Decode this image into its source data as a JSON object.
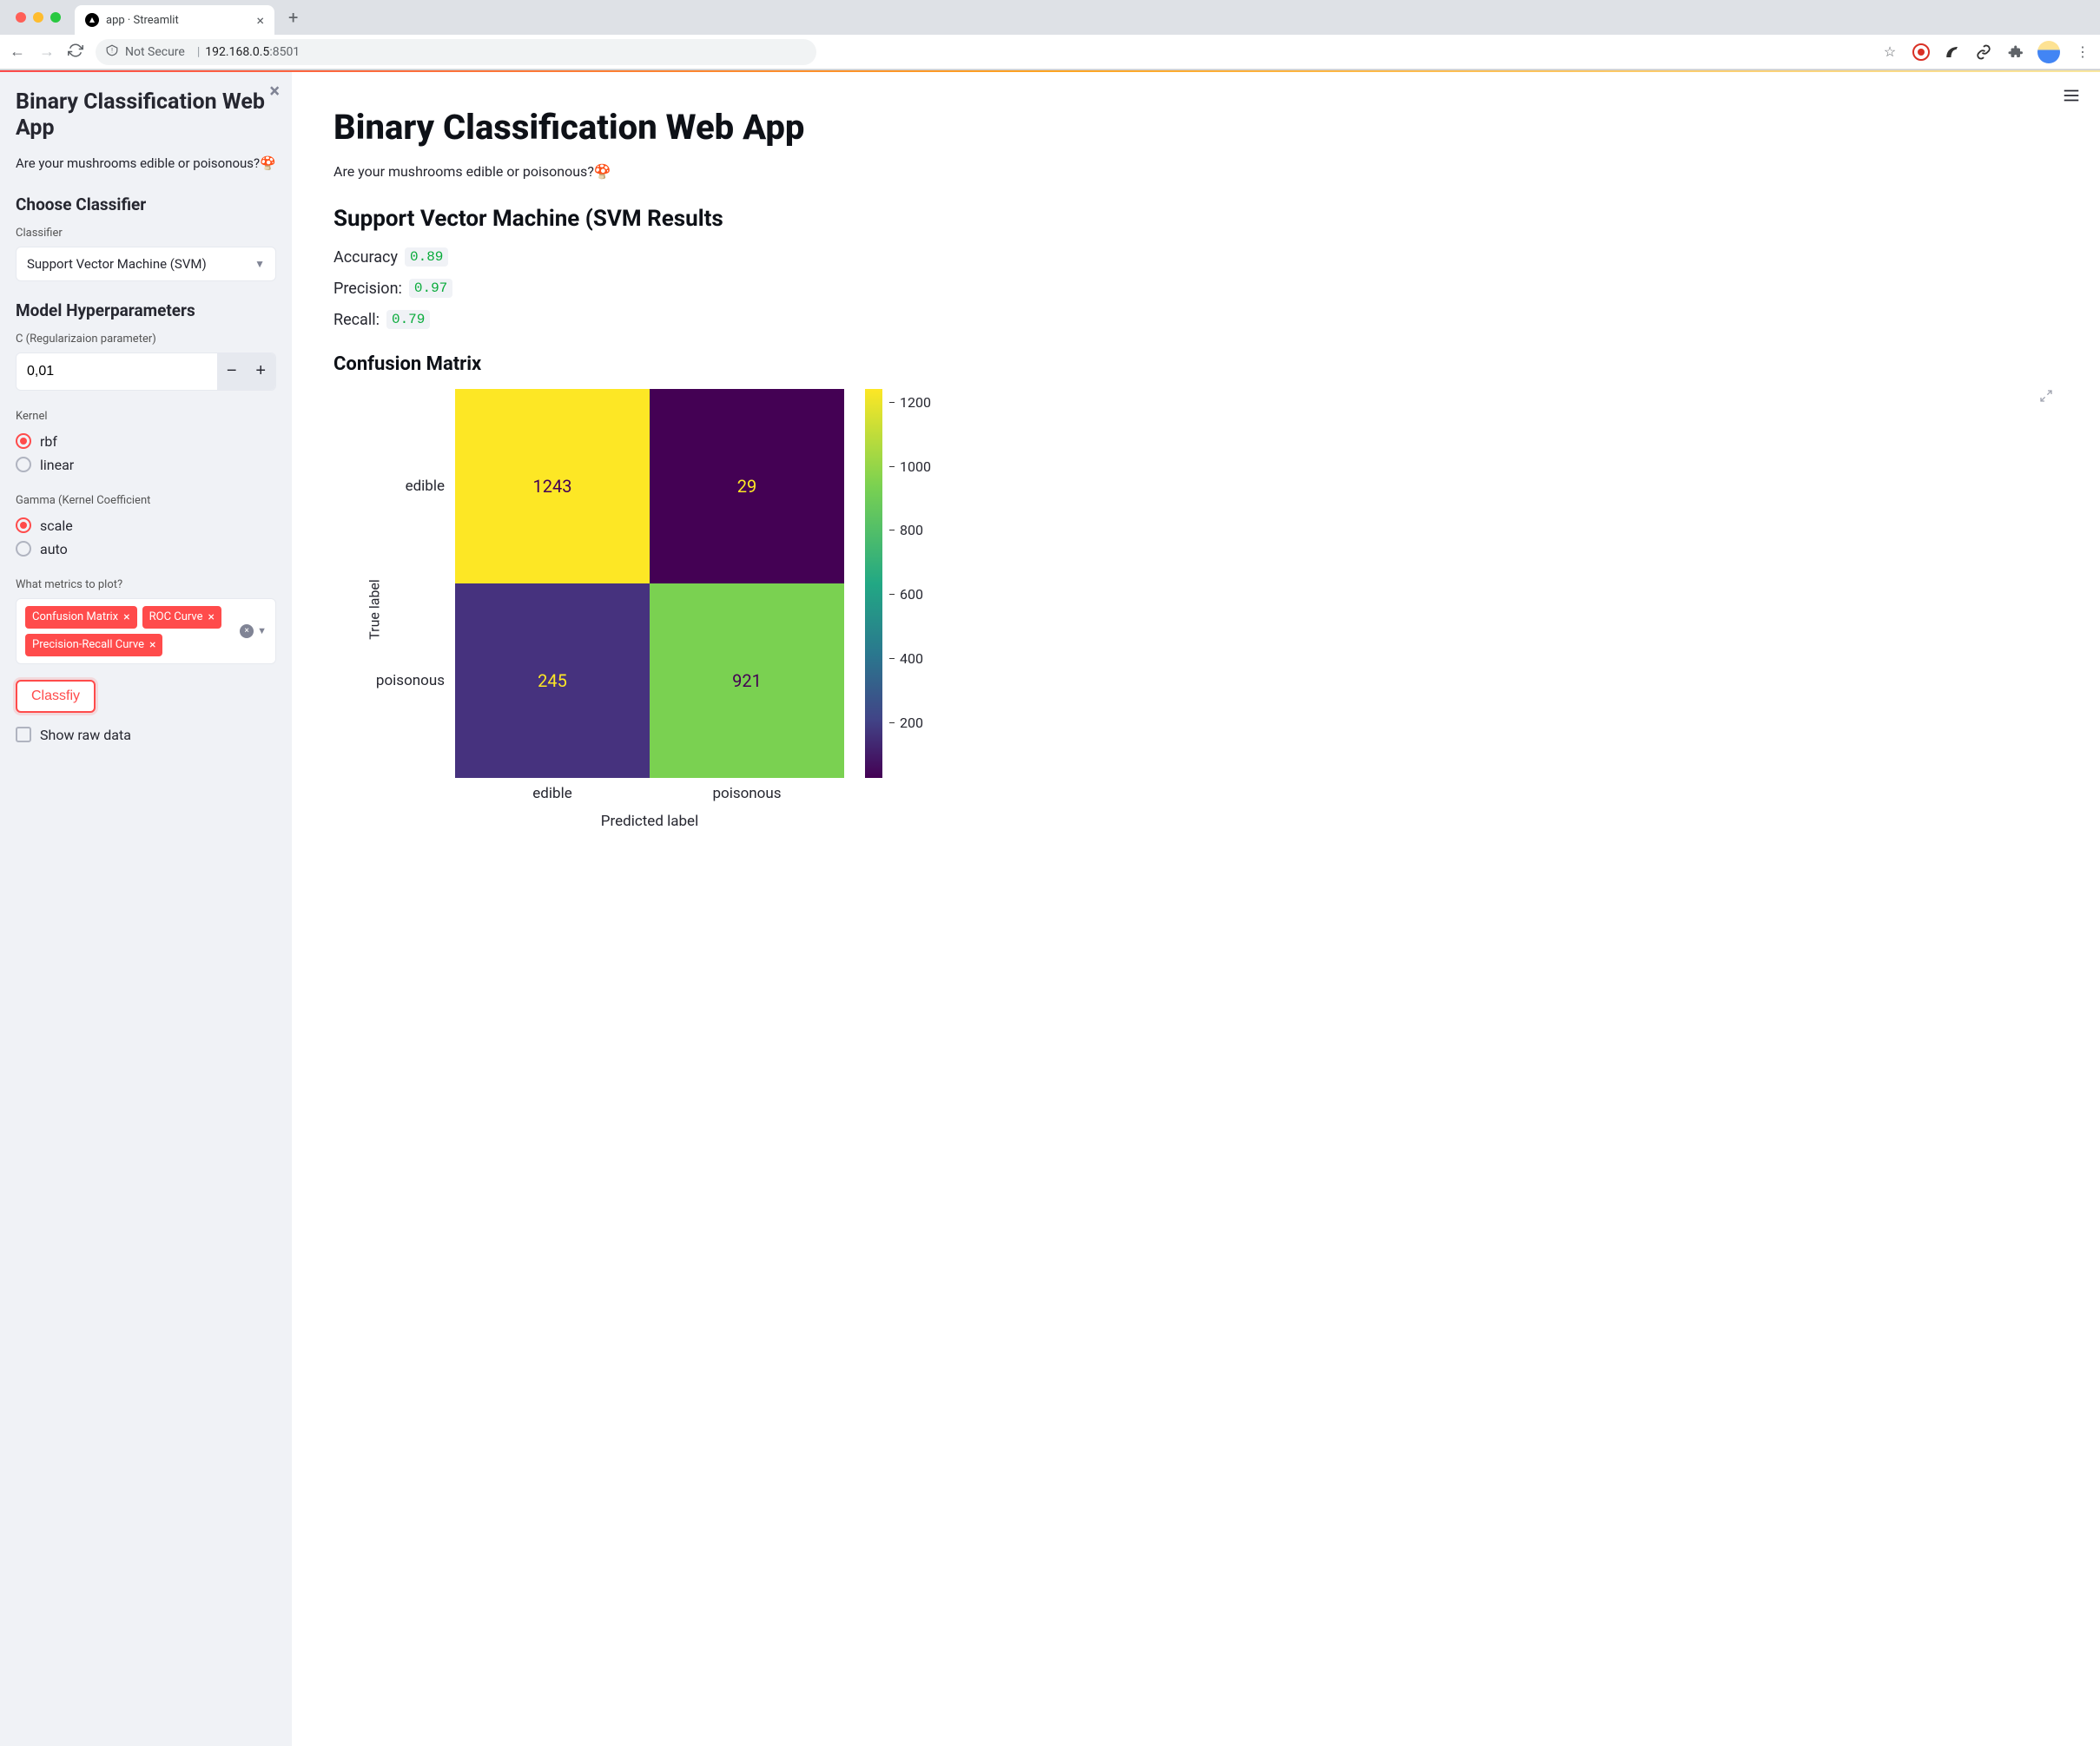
{
  "browser": {
    "tab_title": "app · Streamlit",
    "not_secure": "Not Secure",
    "host": "192.168.0.5",
    "port": ":8501"
  },
  "sidebar": {
    "title": "Binary Classification Web App",
    "subtitle": "Are your mushrooms edible or poisonous?🍄",
    "choose_classifier": "Choose Classifier",
    "classifier_label": "Classifier",
    "classifier_value": "Support Vector Machine (SVM)",
    "hyperparameters": "Model Hyperparameters",
    "c_label": "C (Regularizaion parameter)",
    "c_value": "0,01",
    "kernel_label": "Kernel",
    "kernel_options": [
      "rbf",
      "linear"
    ],
    "kernel_selected": "rbf",
    "gamma_label": "Gamma (Kernel Coefficient",
    "gamma_options": [
      "scale",
      "auto"
    ],
    "gamma_selected": "scale",
    "metrics_label": "What metrics to plot?",
    "metrics_selected": [
      "Confusion Matrix",
      "ROC Curve",
      "Precision-Recall Curve"
    ],
    "classify_button": "Classfiy",
    "show_raw_data": "Show raw data"
  },
  "main": {
    "title": "Binary Classification Web App",
    "subtitle": "Are your mushrooms edible or poisonous?🍄",
    "results_header": "Support Vector Machine (SVM Results",
    "accuracy_label": "Accuracy",
    "accuracy_value": "0.89",
    "precision_label": "Precision:",
    "precision_value": "0.97",
    "recall_label": "Recall:",
    "recall_value": "0.79",
    "confusion_matrix_header": "Confusion Matrix"
  },
  "chart_data": {
    "type": "heatmap",
    "title": "Confusion Matrix",
    "xlabel": "Predicted label",
    "ylabel": "True label",
    "x_categories": [
      "edible",
      "poisonous"
    ],
    "y_categories": [
      "edible",
      "poisonous"
    ],
    "values": [
      [
        1243,
        29
      ],
      [
        245,
        921
      ]
    ],
    "cell_colors": [
      [
        "#fde725",
        "#440154"
      ],
      [
        "#46327e",
        "#7ad151"
      ]
    ],
    "cell_text_colors": [
      [
        "#440154",
        "#fde725"
      ],
      [
        "#fde725",
        "#440154"
      ]
    ],
    "colorbar_ticks": [
      1200,
      1000,
      800,
      600,
      400,
      200
    ],
    "colorbar_range": [
      29,
      1243
    ]
  }
}
